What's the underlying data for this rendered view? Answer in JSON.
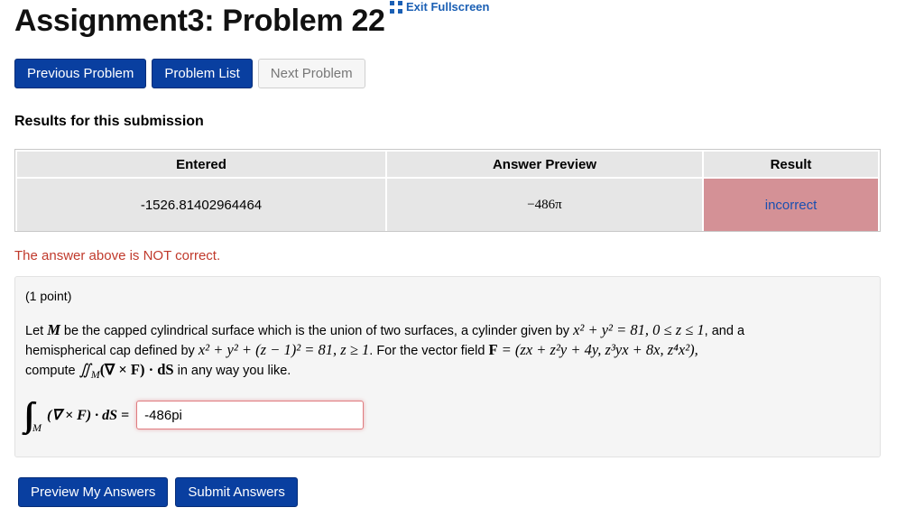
{
  "header": {
    "title": "Assignment3: Problem 22",
    "exit_fullscreen": "Exit Fullscreen"
  },
  "nav": {
    "previous": "Previous Problem",
    "list": "Problem List",
    "next": "Next Problem"
  },
  "results": {
    "heading": "Results for this submission",
    "columns": [
      "Entered",
      "Answer Preview",
      "Result"
    ],
    "row": {
      "entered": "-1526.81402964464",
      "preview": "−486π",
      "result": "incorrect"
    },
    "warning": "The answer above is NOT correct."
  },
  "problem": {
    "points": "(1 point)",
    "line1": {
      "t1": "Let ",
      "m1": "M",
      "t2": " be the capped cylindrical surface which is the union of two surfaces, a cylinder given by ",
      "m2": "x² + y² = 81,  0 ≤ z ≤ 1",
      "t3": ", and a"
    },
    "line2": {
      "t1": "hemispherical cap defined by ",
      "m1": "x² + y² + (z − 1)² = 81,  z ≥ 1",
      "t2": ". For the vector field ",
      "m2": "F",
      "m3": " = (zx + z²y + 4y,  z³yx + 8x,  z⁴x²),"
    },
    "line3": {
      "t1": "compute ",
      "m1": "∬",
      "m2": "M",
      "m3": "(∇ × F) · dS",
      "t2": " in any way you like."
    },
    "answer": {
      "integral": "∫∫",
      "sub": "M",
      "expr": "(∇ × F) · dS =",
      "value": "-486pi"
    }
  },
  "actions": {
    "preview": "Preview My Answers",
    "submit": "Submit Answers"
  },
  "colors": {
    "primary_button": "#093fa0",
    "incorrect_cell": "#d49196",
    "warning_text": "#c0392b",
    "link": "#1a5fb4"
  }
}
